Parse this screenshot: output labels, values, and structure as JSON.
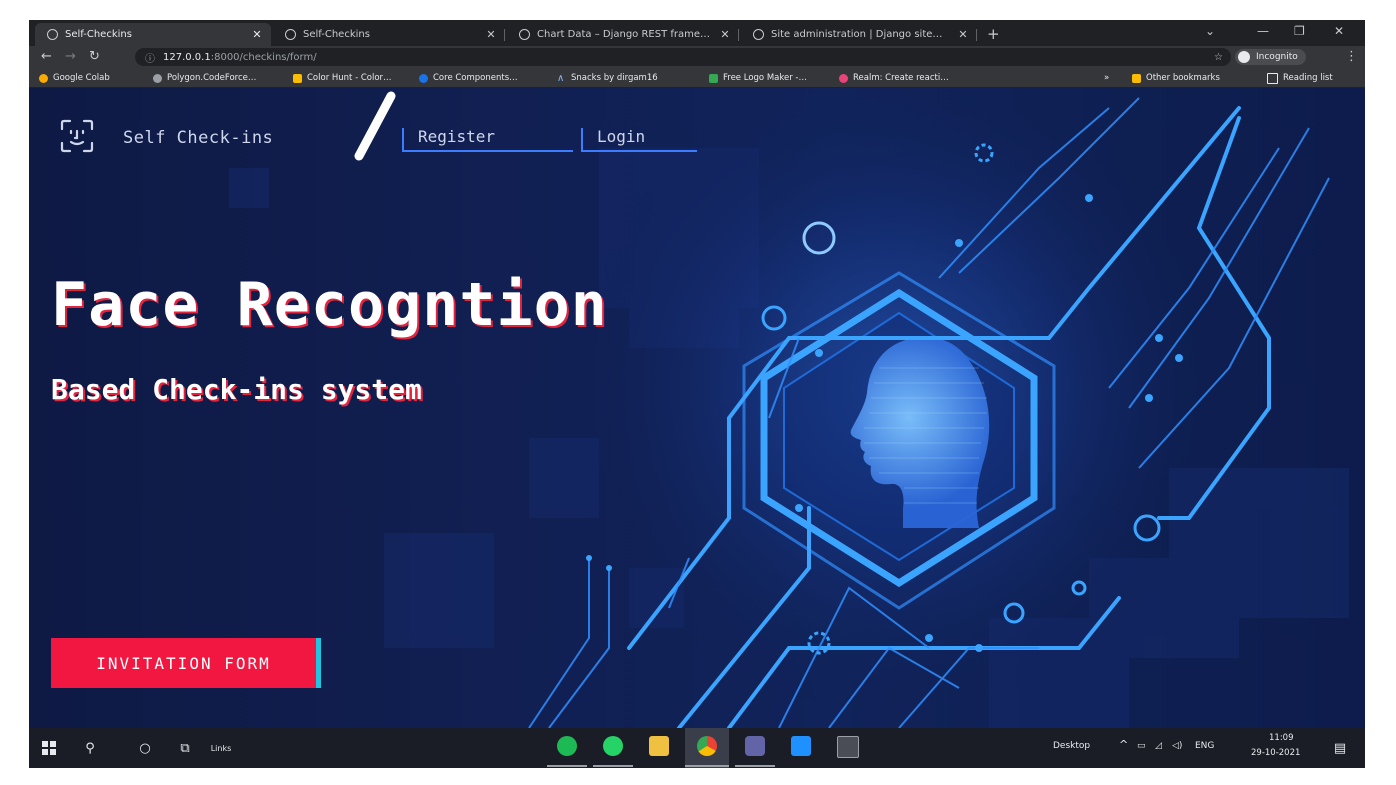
{
  "browser": {
    "tabs": [
      {
        "title": "Self-Checkins",
        "active": true
      },
      {
        "title": "Self-Checkins",
        "active": false
      },
      {
        "title": "Chart Data – Django REST frame…",
        "active": false
      },
      {
        "title": "Site administration | Django site…",
        "active": false
      }
    ],
    "url_host": "127.0.0.1",
    "url_path": ":8000/checkins/form/",
    "profile_label": "Incognito",
    "bookmarks": [
      {
        "label": "Google Colab",
        "color": "#f9ab00"
      },
      {
        "label": "Polygon.CodeForce…",
        "color": "#9aa0a6"
      },
      {
        "label": "Color Hunt - Color…",
        "color": "#fbbc04"
      },
      {
        "label": "Core Components…",
        "color": "#1a73e8"
      },
      {
        "label": "Snacks by dirgam16",
        "color": "#3c4f9a"
      },
      {
        "label": "Free Logo Maker -…",
        "color": "#34a853"
      },
      {
        "label": "Realm: Create reacti…",
        "color": "#e8447a"
      }
    ],
    "other_bookmarks": "Other bookmarks",
    "reading_list": "Reading list"
  },
  "page": {
    "brand": "Self Check-ins",
    "nav": {
      "register": "Register",
      "login": "Login"
    },
    "headline": "Face Recogntion",
    "subheadline": "Based Check-ins system",
    "cta_label": "INVITATION FORM"
  },
  "taskbar": {
    "links_label": "Links",
    "desktop_label": "Desktop",
    "lang": "ENG",
    "time": "11:09",
    "date": "29-10-2021",
    "apps": [
      "spotify-icon",
      "whatsapp-icon",
      "file-explorer-icon",
      "chrome-icon",
      "teams-icon",
      "vscode-icon",
      "terminal-icon"
    ]
  },
  "colors": {
    "accent_red": "#f21740",
    "accent_cyan": "#22c4e0",
    "circuit_blue": "#3aa4ff",
    "nav_underline": "#3d7cff"
  }
}
